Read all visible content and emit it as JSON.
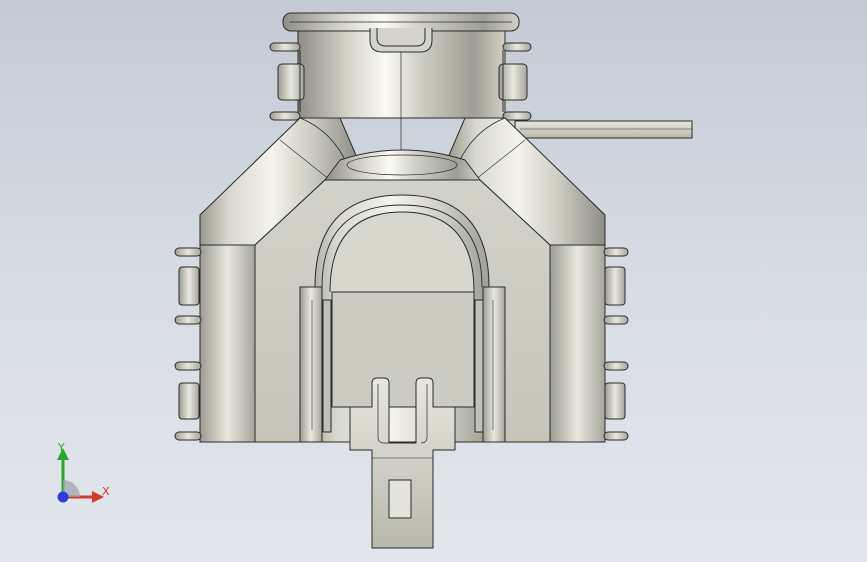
{
  "viewport": {
    "background_top": "#c4cad3",
    "background_bottom": "#e3e7ec"
  },
  "model": {
    "view": "front",
    "metal_light": "#f2f1ea",
    "metal_mid": "#c9c8bd",
    "metal_dark": "#8d8c84",
    "edge_color": "#2a2a2a"
  },
  "triad": {
    "x_label": "X",
    "y_label": "Y",
    "x_color": "#d43a2e",
    "y_color": "#2aa52f",
    "z_color": "#2b3fd6",
    "icon": "coordinate-triad-icon"
  }
}
